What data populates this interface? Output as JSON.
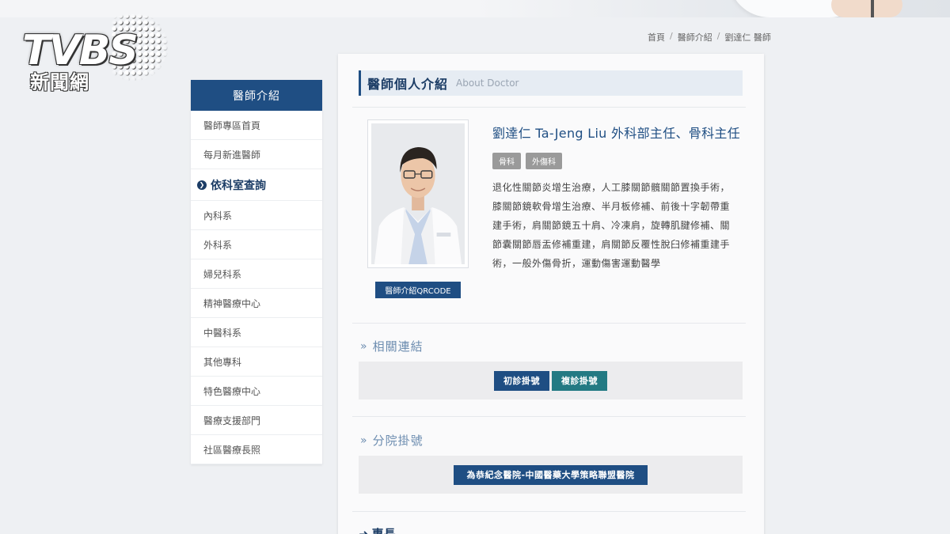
{
  "logo": {
    "brand": "TVBS",
    "subtitle": "新聞網"
  },
  "breadcrumb": [
    "首頁",
    "醫師介紹",
    "劉達仁 醫師"
  ],
  "sidebar": {
    "title": "醫師介紹",
    "items": [
      {
        "label": "醫師專區首頁",
        "type": "link"
      },
      {
        "label": "每月新進醫師",
        "type": "link"
      },
      {
        "label": "依科室查詢",
        "type": "section"
      },
      {
        "label": "內科系",
        "type": "link"
      },
      {
        "label": "外科系",
        "type": "link"
      },
      {
        "label": "婦兒科系",
        "type": "link"
      },
      {
        "label": "精神醫療中心",
        "type": "link"
      },
      {
        "label": "中醫科系",
        "type": "link"
      },
      {
        "label": "其他專科",
        "type": "link"
      },
      {
        "label": "特色醫療中心",
        "type": "link"
      },
      {
        "label": "醫療支援部門",
        "type": "link"
      },
      {
        "label": "社區醫療長照",
        "type": "link"
      }
    ]
  },
  "main": {
    "title_zh": "醫師個人介紹",
    "title_en": "About Doctor",
    "doctor_name": "劉達仁 Ta-Jeng Liu 外科部主任、骨科主任",
    "tags": [
      "骨科",
      "外傷科"
    ],
    "bio": "退化性關節炎增生治療，人工膝關節髖關節置換手術，膝關節鏡軟骨增生治療、半月板修補、前後十字韌帶重建手術，肩關節鏡五十肩、冷凍肩，旋轉肌腱修補、關節囊關節唇盂修補重建，肩關節反覆性脫臼修補重建手術，一般外傷骨折，運動傷害運動醫學",
    "qr_label": "醫師介紹QRCODE",
    "related": {
      "title": "相關連結",
      "buttons": [
        "初診掛號",
        "複診掛號"
      ]
    },
    "branch": {
      "title": "分院掛號",
      "button": "為恭紀念醫院-中國醫藥大學策略聯盟醫院"
    },
    "next_section": "專長"
  },
  "colors": {
    "navy": "#1f4e83",
    "teal": "#237a83",
    "tag_gray": "#9a9a9a",
    "sub_heading": "#6d8db0"
  }
}
